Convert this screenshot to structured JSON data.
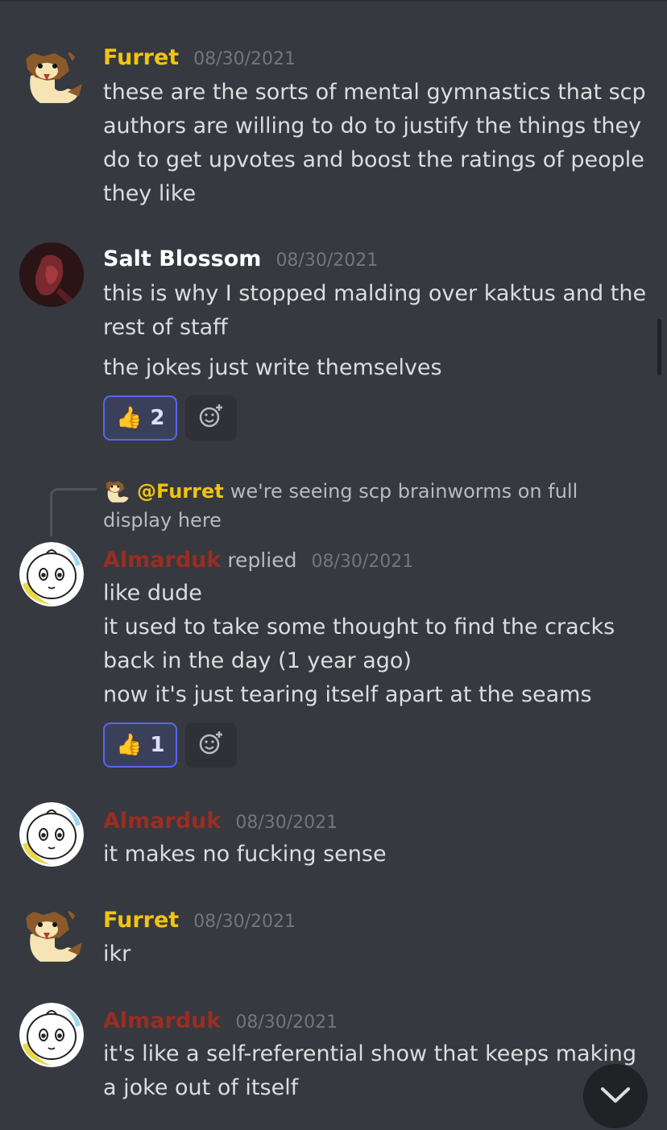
{
  "messages": [
    {
      "author": "Furret",
      "timestamp": "08/30/2021",
      "lines": [
        "these are the sorts of mental gymnastics that scp authors are willing to do to justify the things they do to get upvotes and boost the ratings of people they like"
      ],
      "avatar_icon": "furret-avatar-icon"
    },
    {
      "author": "Salt Blossom",
      "timestamp": "08/30/2021",
      "lines": [
        "this is why I stopped malding over kaktus and the rest of staff",
        "the jokes just write themselves"
      ],
      "reaction": {
        "emoji": "👍",
        "count": "2"
      },
      "avatar_icon": "salt-blossom-avatar-icon"
    },
    {
      "reply_to": {
        "author": "@Furret",
        "text": "we're seeing scp brainworms on full display here"
      },
      "author": "Almarduk",
      "replied_label": "replied",
      "timestamp": "08/30/2021",
      "lines": [
        "like dude",
        "it used to take some thought to find the cracks back in the day (1 year ago)",
        "now it's just tearing itself apart at the seams"
      ],
      "reaction": {
        "emoji": "👍",
        "count": "1"
      },
      "avatar_icon": "almarduk-avatar-icon"
    },
    {
      "author": "Almarduk",
      "timestamp": "08/30/2021",
      "lines": [
        "it makes no fucking sense"
      ],
      "avatar_icon": "almarduk-avatar-icon"
    },
    {
      "author": "Furret",
      "timestamp": "08/30/2021",
      "lines": [
        "ikr"
      ],
      "avatar_icon": "furret-avatar-icon"
    },
    {
      "author": "Almarduk",
      "timestamp": "08/30/2021",
      "lines": [
        "it's like a self-referential show that keeps making a joke out of itself"
      ],
      "avatar_icon": "almarduk-avatar-icon"
    }
  ],
  "colors": {
    "background": "#36393f",
    "furret_name": "#f1c40f",
    "almarduk_name": "#992d22",
    "salt_blossom_name": "#ffffff",
    "reaction_border": "#5865f2"
  },
  "icons": {
    "add_reaction": "add-reaction-icon",
    "jump_to_present": "chevron-down-icon"
  }
}
